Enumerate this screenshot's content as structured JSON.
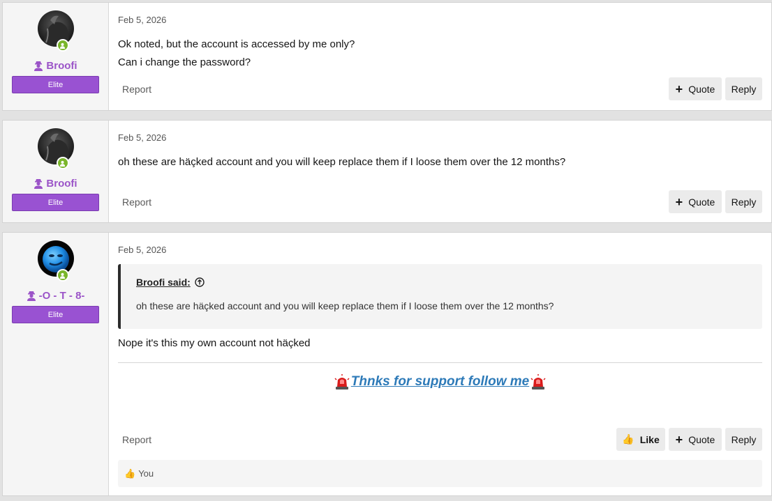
{
  "posts": [
    {
      "author": "Broofi",
      "role": "Elite",
      "date": "Feb 5, 2026",
      "body_lines": [
        "Ok noted, but the account is accessed by me only?",
        "Can i change the password?"
      ],
      "report": "Report",
      "quote_label": "Quote",
      "reply_label": "Reply"
    },
    {
      "author": "Broofi",
      "role": "Elite",
      "date": "Feb 5, 2026",
      "body_lines": [
        "oh these are häçked account and you will keep replace them if I loose them over the 12 months?"
      ],
      "report": "Report",
      "quote_label": "Quote",
      "reply_label": "Reply"
    },
    {
      "author": "-O - T - 8-",
      "role": "Elite",
      "date": "Feb 5, 2026",
      "quote": {
        "attribution": "Broofi said:",
        "text": "oh these are häçked account and you will keep replace them if I loose them over the 12 months?"
      },
      "body_lines": [
        "Nope it's this my own account not häçked"
      ],
      "signature": "Thnks for support follow me",
      "report": "Report",
      "like_label": "Like",
      "quote_label": "Quote",
      "reply_label": "Reply",
      "reactions": "You"
    }
  ],
  "colors": {
    "username": "#9b54c8",
    "role_banner": "#9952d2",
    "online": "#7ab62b",
    "signature": "#2d7ab8"
  },
  "icons": {
    "user_icon": "user-badge-icon",
    "online": "online-status-icon",
    "quote_arrow": "circle-arrow-up-icon",
    "siren": "siren-icon",
    "thumbs_up": "thumbs-up-icon",
    "plus": "plus-icon"
  }
}
